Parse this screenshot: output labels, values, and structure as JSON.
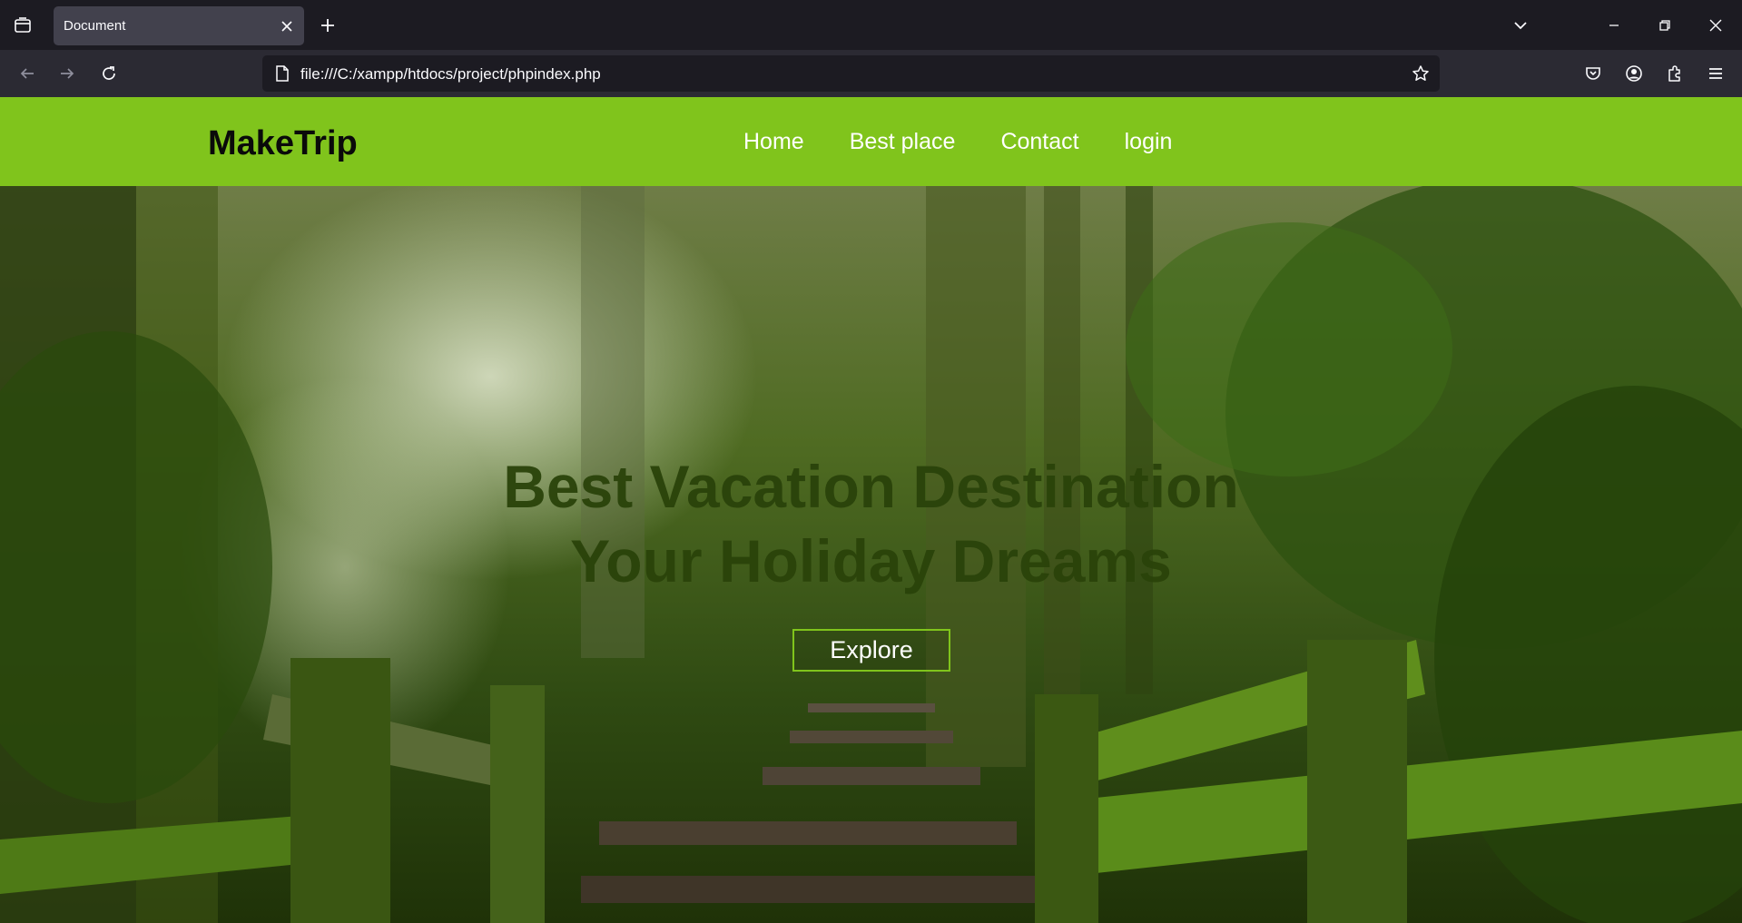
{
  "browser": {
    "tab": {
      "title": "Document"
    },
    "url": "file:///C:/xampp/htdocs/project/phpindex.php"
  },
  "site": {
    "logo": "MakeTrip",
    "nav": [
      "Home",
      "Best place",
      "Contact",
      "login"
    ],
    "hero": {
      "title_line1": "Best Vacation Destination",
      "title_line2": "Your Holiday Dreams",
      "button": "Explore"
    }
  },
  "colors": {
    "header_bg": "#80c41c",
    "hero_title": "#2a430a",
    "browser_dark": "#1c1b22",
    "browser_toolbar": "#2b2a33"
  }
}
